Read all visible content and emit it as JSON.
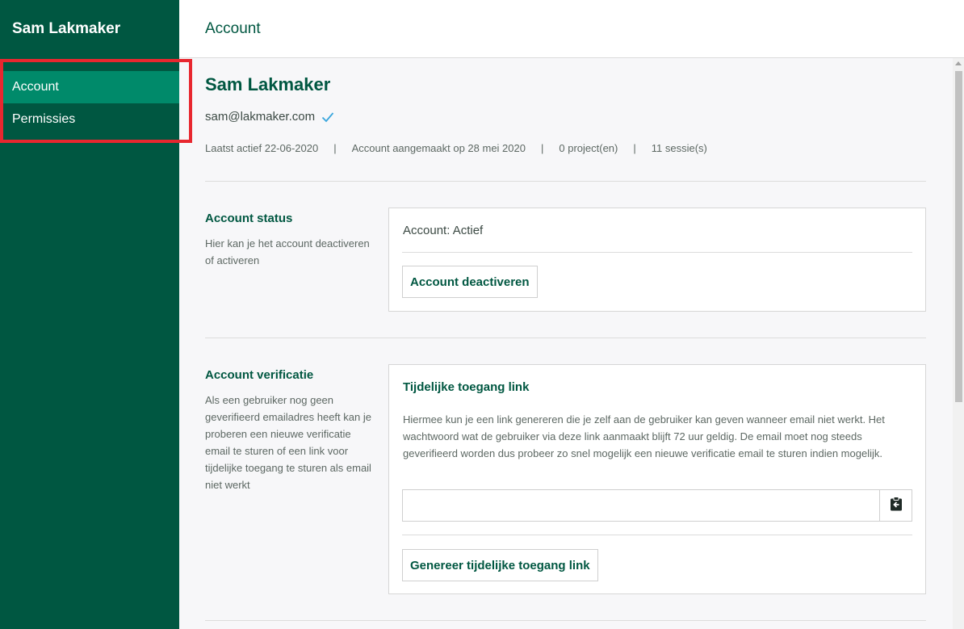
{
  "app": {
    "user_title": "Sam Lakmaker"
  },
  "sidebar": {
    "items": [
      {
        "label": "Account",
        "active": true
      },
      {
        "label": "Permissies",
        "active": false
      }
    ]
  },
  "header": {
    "title": "Account"
  },
  "profile": {
    "name": "Sam Lakmaker",
    "email": "sam@lakmaker.com",
    "verified_icon": "checkmark-icon",
    "meta": {
      "last_active": "Laatst actief 22-06-2020",
      "created": "Account aangemaakt op 28 mei 2020",
      "projects": "0 project(en)",
      "sessions": "11 sessie(s)",
      "separator": "|"
    }
  },
  "account_status": {
    "title": "Account status",
    "description": "Hier kan je het account deactiveren of activeren",
    "status_text": "Account: Actief",
    "button_label": "Account deactiveren"
  },
  "account_verification": {
    "title": "Account verificatie",
    "description": "Als een gebruiker nog geen geverifieerd emailadres heeft kan je proberen een nieuwe verificatie email te sturen of een link voor tijdelijke toegang te sturen als email niet werkt",
    "card_title": "Tijdelijke toegang link",
    "card_description": "Hiermee kun je een link genereren die je zelf aan de gebruiker kan geven wanneer email niet werkt. Het wachtwoord wat de gebruiker via deze link aanmaakt blijft 72 uur geldig. De email moet nog steeds geverifieerd worden dus probeer zo snel mogelijk een nieuwe verificatie email te sturen indien mogelijk.",
    "link_value": "",
    "copy_icon": "clipboard-icon",
    "button_label": "Genereer tijdelijke toegang link"
  },
  "colors": {
    "sidebar_bg": "#005741",
    "sidebar_active": "#008a6a",
    "accent_text": "#005741",
    "verified_check": "#3aa6dd",
    "highlight": "#e8272f"
  }
}
